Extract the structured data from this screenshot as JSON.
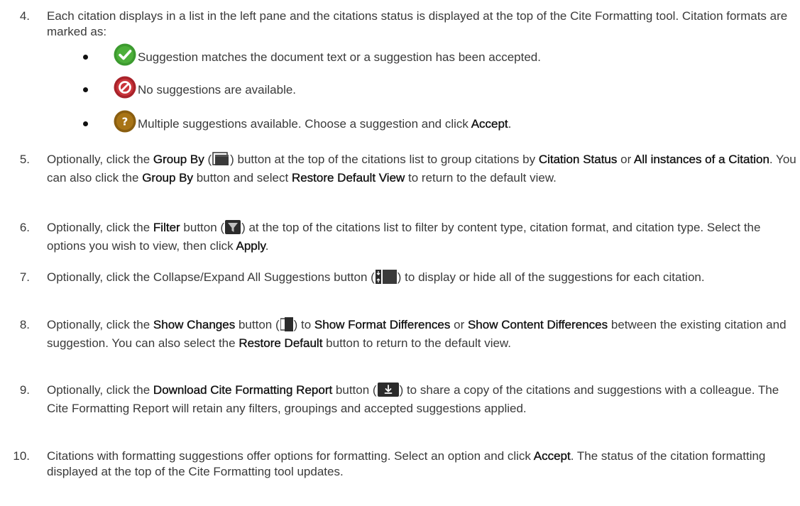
{
  "steps": [
    {
      "num": "4.",
      "segments": [
        {
          "t": "Each citation displays in a list in the left pane and the citations status is displayed at the top of the Cite Formatting tool. Citation formats are marked as:"
        }
      ]
    },
    {
      "num": "5.",
      "segments": [
        {
          "t": "Optionally, click the "
        },
        {
          "t": "Group By",
          "b": true
        },
        {
          "t": " ("
        },
        {
          "icon": "group-by-icon"
        },
        {
          "t": ") button at the top of the citations list to group citations by "
        },
        {
          "t": "Citation Status",
          "b": true
        },
        {
          "t": " or "
        },
        {
          "t": "All instances of a Citation",
          "b": true
        },
        {
          "t": ". You can also click the "
        },
        {
          "t": "Group By",
          "b": true
        },
        {
          "t": " button and select "
        },
        {
          "t": "Restore Default View",
          "b": true
        },
        {
          "t": " to return to the default view."
        }
      ]
    },
    {
      "num": "6.",
      "segments": [
        {
          "t": "Optionally, click the "
        },
        {
          "t": "Filter",
          "b": true
        },
        {
          "t": " button ("
        },
        {
          "icon": "filter-icon"
        },
        {
          "t": ") at the top of the citations list to filter by content type, citation format, and citation type. Select the options you wish to view, then click "
        },
        {
          "t": "Apply",
          "b": true
        },
        {
          "t": "."
        }
      ]
    },
    {
      "num": "7.",
      "segments": [
        {
          "t": "Optionally, click the Collapse/Expand All Suggestions button ("
        },
        {
          "icon": "collapse-expand-icon"
        },
        {
          "t": ") to display or hide all of the suggestions for each citation."
        }
      ]
    },
    {
      "num": "8.",
      "segments": [
        {
          "t": "Optionally, click the "
        },
        {
          "t": "Show Changes",
          "b": true
        },
        {
          "t": " button ("
        },
        {
          "icon": "show-changes-icon"
        },
        {
          "t": ") to "
        },
        {
          "t": "Show Format Differences",
          "b": true
        },
        {
          "t": " or "
        },
        {
          "t": "Show Content Differences",
          "b": true
        },
        {
          "t": " between the existing citation and suggestion. You can also select the "
        },
        {
          "t": "Restore Default",
          "b": true
        },
        {
          "t": " button to return to the default view."
        }
      ]
    },
    {
      "num": "9.",
      "segments": [
        {
          "t": "Optionally, click the "
        },
        {
          "t": "Download Cite Formatting Report",
          "b": true
        },
        {
          "t": " button ("
        },
        {
          "icon": "download-icon"
        },
        {
          "t": ") to share a copy of the citations and suggestions with a colleague. The Cite Formatting Report will retain any filters, groupings and accepted suggestions applied."
        }
      ]
    },
    {
      "num": "10.",
      "segments": [
        {
          "t": "Citations with formatting suggestions offer options for formatting. Select an option and click "
        },
        {
          "t": "Accept",
          "b": true
        },
        {
          "t": ". The status of the citation formatting displayed at the top of the Cite Formatting tool updates."
        }
      ]
    }
  ],
  "legend": [
    {
      "icon": "check-icon",
      "color": "#3c9a2f",
      "segments": [
        {
          "t": "Suggestion matches the document text or a suggestion has been accepted."
        }
      ]
    },
    {
      "icon": "no-entry-icon",
      "color": "#b8282d",
      "segments": [
        {
          "t": "No suggestions are available."
        }
      ]
    },
    {
      "icon": "question-icon",
      "color": "#9a6a12",
      "segments": [
        {
          "t": "Multiple suggestions available. Choose a suggestion and click "
        },
        {
          "t": "Accept",
          "b": true
        },
        {
          "t": "."
        }
      ]
    }
  ]
}
